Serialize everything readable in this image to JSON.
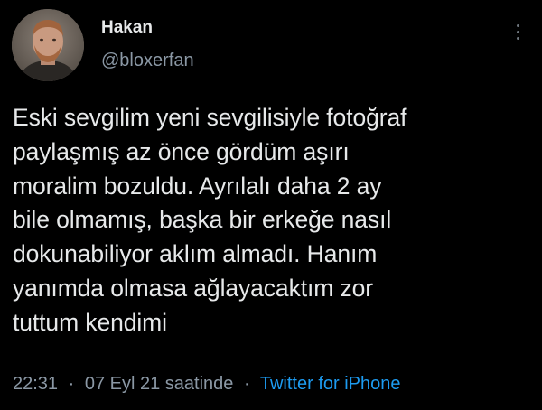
{
  "author": {
    "display_name": "Hakan",
    "handle": "@bloxerfan"
  },
  "tweet": {
    "lines": [
      "Eski sevgilim yeni sevgilisiyle fotoğraf",
      "paylaşmış az önce gördüm aşırı",
      "moralim bozuldu. Ayrılalı daha 2 ay",
      "bile olmamış, başka bir erkeğe nasıl",
      "dokunabiliyor aklım almadı. Hanım",
      "yanımda olmasa ağlayacaktım zor",
      "tuttum kendimi"
    ]
  },
  "meta": {
    "time": "22:31",
    "separator": "·",
    "date": "07 Eyl 21 saatinde",
    "source": "Twitter for iPhone"
  },
  "icons": {
    "more": "more-vertical-icon",
    "avatar": "profile-photo"
  },
  "colors": {
    "background": "#000000",
    "text_primary": "#e7e9ea",
    "text_secondary": "#8b98a5",
    "accent": "#1d9bf0"
  }
}
